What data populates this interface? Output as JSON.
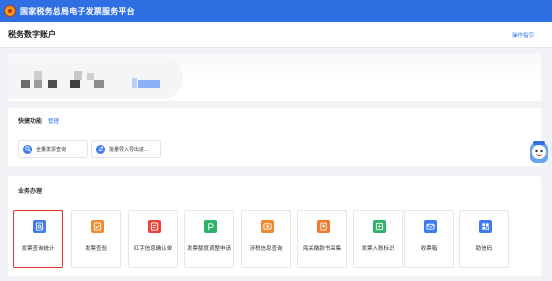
{
  "app": {
    "title": "国家税务总局电子发票服务平台"
  },
  "header": {
    "page_title": "税务数字账户",
    "guide_link": "操作指引"
  },
  "quick": {
    "title": "快捷功能",
    "manage": "管理",
    "buttons": [
      {
        "label": "全量发票查询",
        "icon": "search-icon"
      },
      {
        "label": "批量导入导出进...",
        "icon": "transfer-icon"
      }
    ]
  },
  "business": {
    "title": "业务办理",
    "tiles": [
      {
        "label": "发票查询统计",
        "icon": "invoice-search-icon",
        "color": "#3e7bf0",
        "selected": true
      },
      {
        "label": "发票查验",
        "icon": "invoice-verify-icon",
        "color": "#f08a2e",
        "selected": false
      },
      {
        "label": "红字信息确认单",
        "icon": "red-letter-icon",
        "color": "#e8453c",
        "selected": false
      },
      {
        "label": "发票额度调整申请",
        "icon": "quota-icon",
        "color": "#2fb36b",
        "selected": false
      },
      {
        "label": "涉税信息查询",
        "icon": "tax-info-icon",
        "color": "#f08a2e",
        "selected": false
      },
      {
        "label": "海关缴款书采集",
        "icon": "customs-icon",
        "color": "#f07a2e",
        "selected": false
      },
      {
        "label": "发票入账标识",
        "icon": "bookkeeping-icon",
        "color": "#2fb36b",
        "selected": false
      },
      {
        "label": "收票箱",
        "icon": "mailbox-icon",
        "color": "#3e7bf0",
        "selected": false
      },
      {
        "label": "助信码",
        "icon": "code-icon",
        "color": "#3e7bf0",
        "selected": false
      }
    ]
  },
  "colors": {
    "brand": "#2f6fe4",
    "selected_border": "#d9342b"
  }
}
